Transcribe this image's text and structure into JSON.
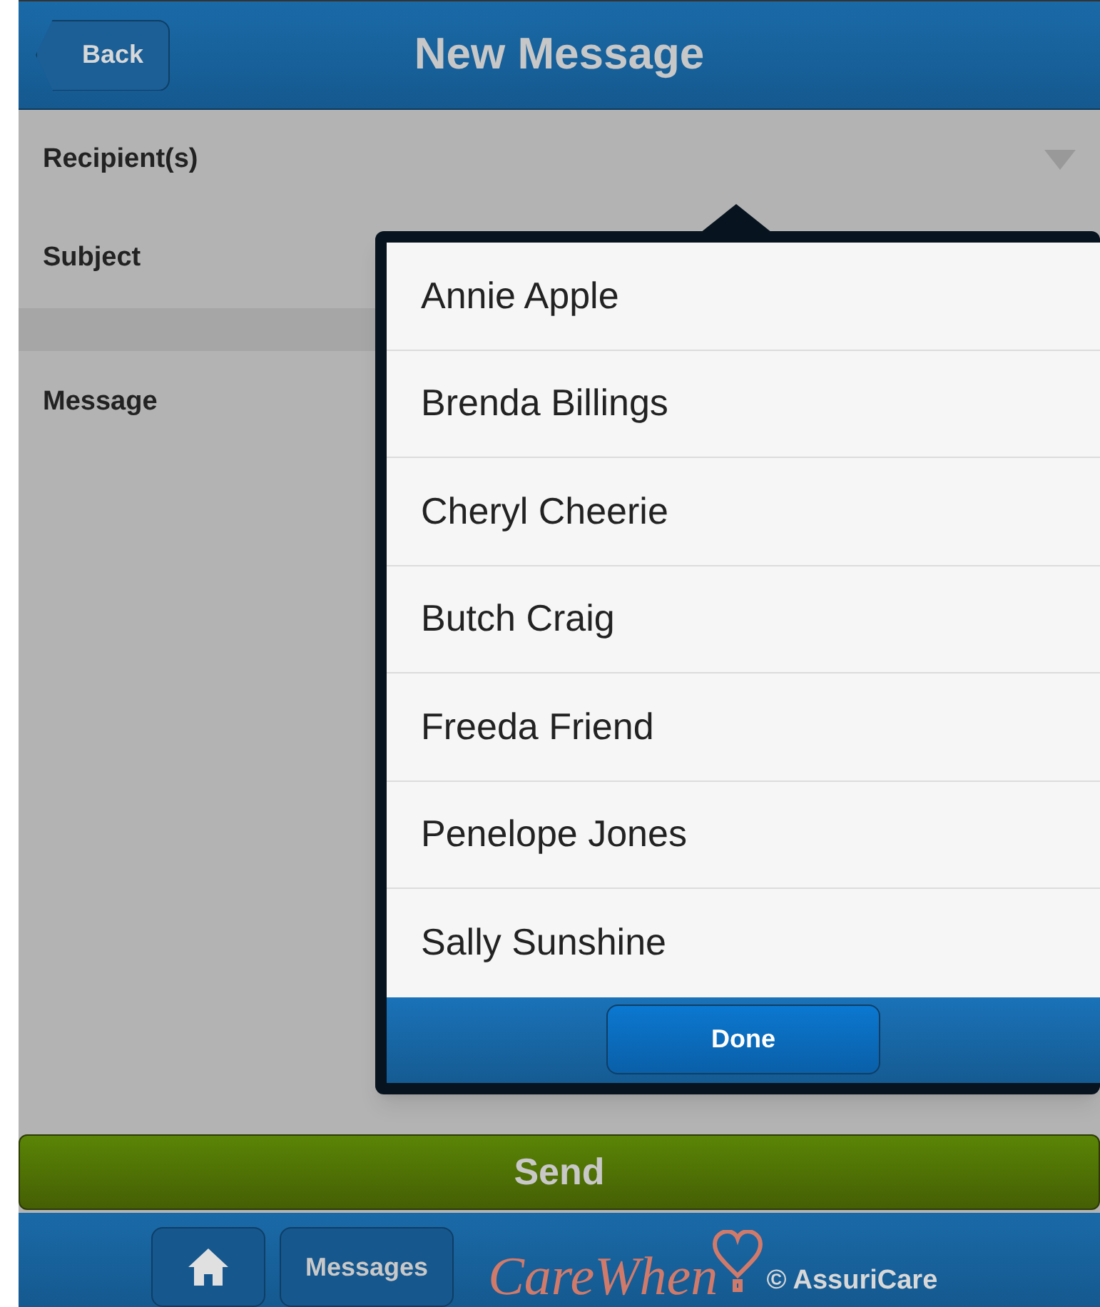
{
  "header": {
    "back": "Back",
    "title": "New Message"
  },
  "form": {
    "fields": [
      {
        "label": "Recipient(s)",
        "kind": "select"
      },
      {
        "label": "Subject",
        "kind": "text"
      },
      {
        "label": "Message",
        "kind": "textarea"
      }
    ]
  },
  "picker": {
    "items": [
      {
        "label": "Annie Apple"
      },
      {
        "label": "Brenda Billings"
      },
      {
        "label": "Cheryl Cheerie"
      },
      {
        "label": "Butch Craig"
      },
      {
        "label": "Freeda Friend"
      },
      {
        "label": "Penelope Jones"
      },
      {
        "label": "Sally Sunshine"
      }
    ],
    "done": "Done"
  },
  "send": "Send",
  "footer": {
    "messages": "Messages",
    "logo": "CareWhen",
    "copyright": "© AssuriCare"
  }
}
